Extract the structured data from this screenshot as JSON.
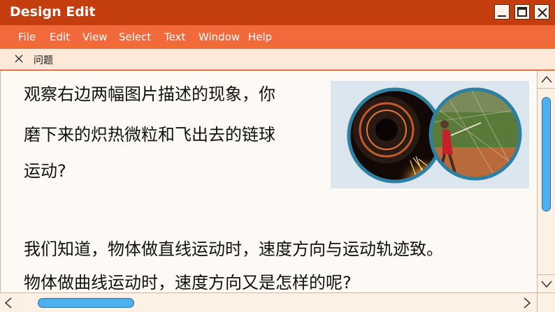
{
  "window": {
    "title": "Design Edit"
  },
  "menu": [
    "File",
    "Edit",
    "View",
    "Select",
    "Text",
    "Window",
    "Help"
  ],
  "tab": {
    "label": "问题"
  },
  "content": {
    "lines": [
      "观察右边两幅图片描述的现象，你",
      "磨下来的炽热微粒和飞出去的链球",
      "运动?",
      "我们知道，物体做直线运动时，速度方向与运动轨迹致。",
      "物体做曲线运动时，速度方向又是怎样的呢?"
    ]
  },
  "colors": {
    "titlebar": "#c43d0f",
    "menubar": "#f26a3c",
    "tabbar": "#fde9d9",
    "scroll_thumb": "#4fb0ee"
  }
}
